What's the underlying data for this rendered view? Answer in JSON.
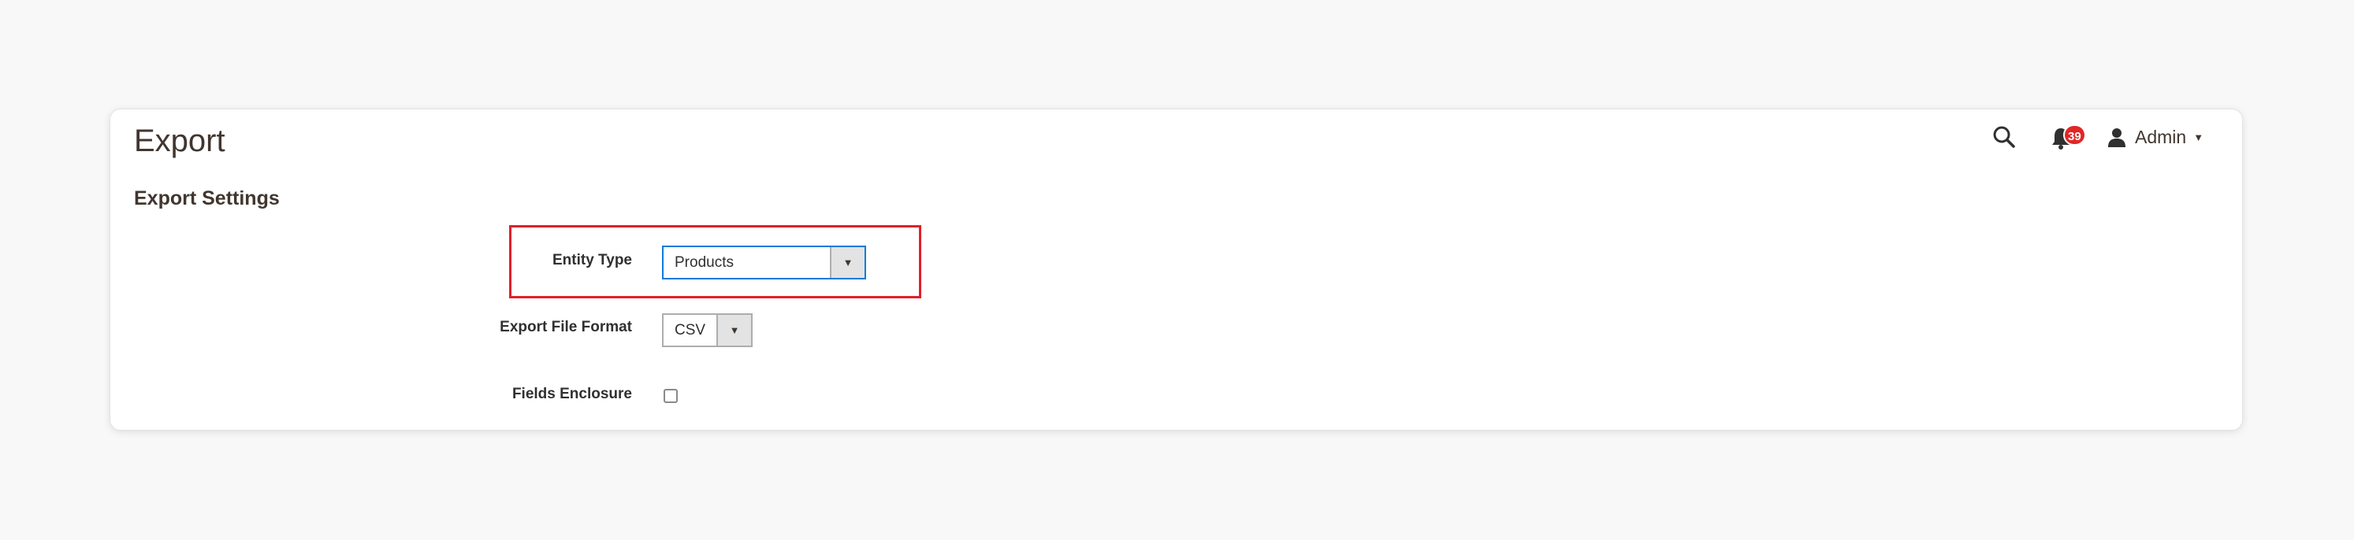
{
  "header": {
    "title": "Export",
    "notifications_count": "39",
    "user_name": "Admin",
    "icons": {
      "search": "search-icon",
      "notifications": "bell-icon",
      "user": "user-icon",
      "caret": "caret-down-icon"
    }
  },
  "settings": {
    "section_title": "Export Settings",
    "entity_type": {
      "label": "Entity Type",
      "value": "Products"
    },
    "file_format": {
      "label": "Export File Format",
      "value": "CSV"
    },
    "fields_enclosure": {
      "label": "Fields Enclosure",
      "checked": false
    }
  },
  "colors": {
    "accent": "#007bdb",
    "highlight": "#e0202a",
    "badge": "#e22626",
    "text": "#41362f"
  }
}
